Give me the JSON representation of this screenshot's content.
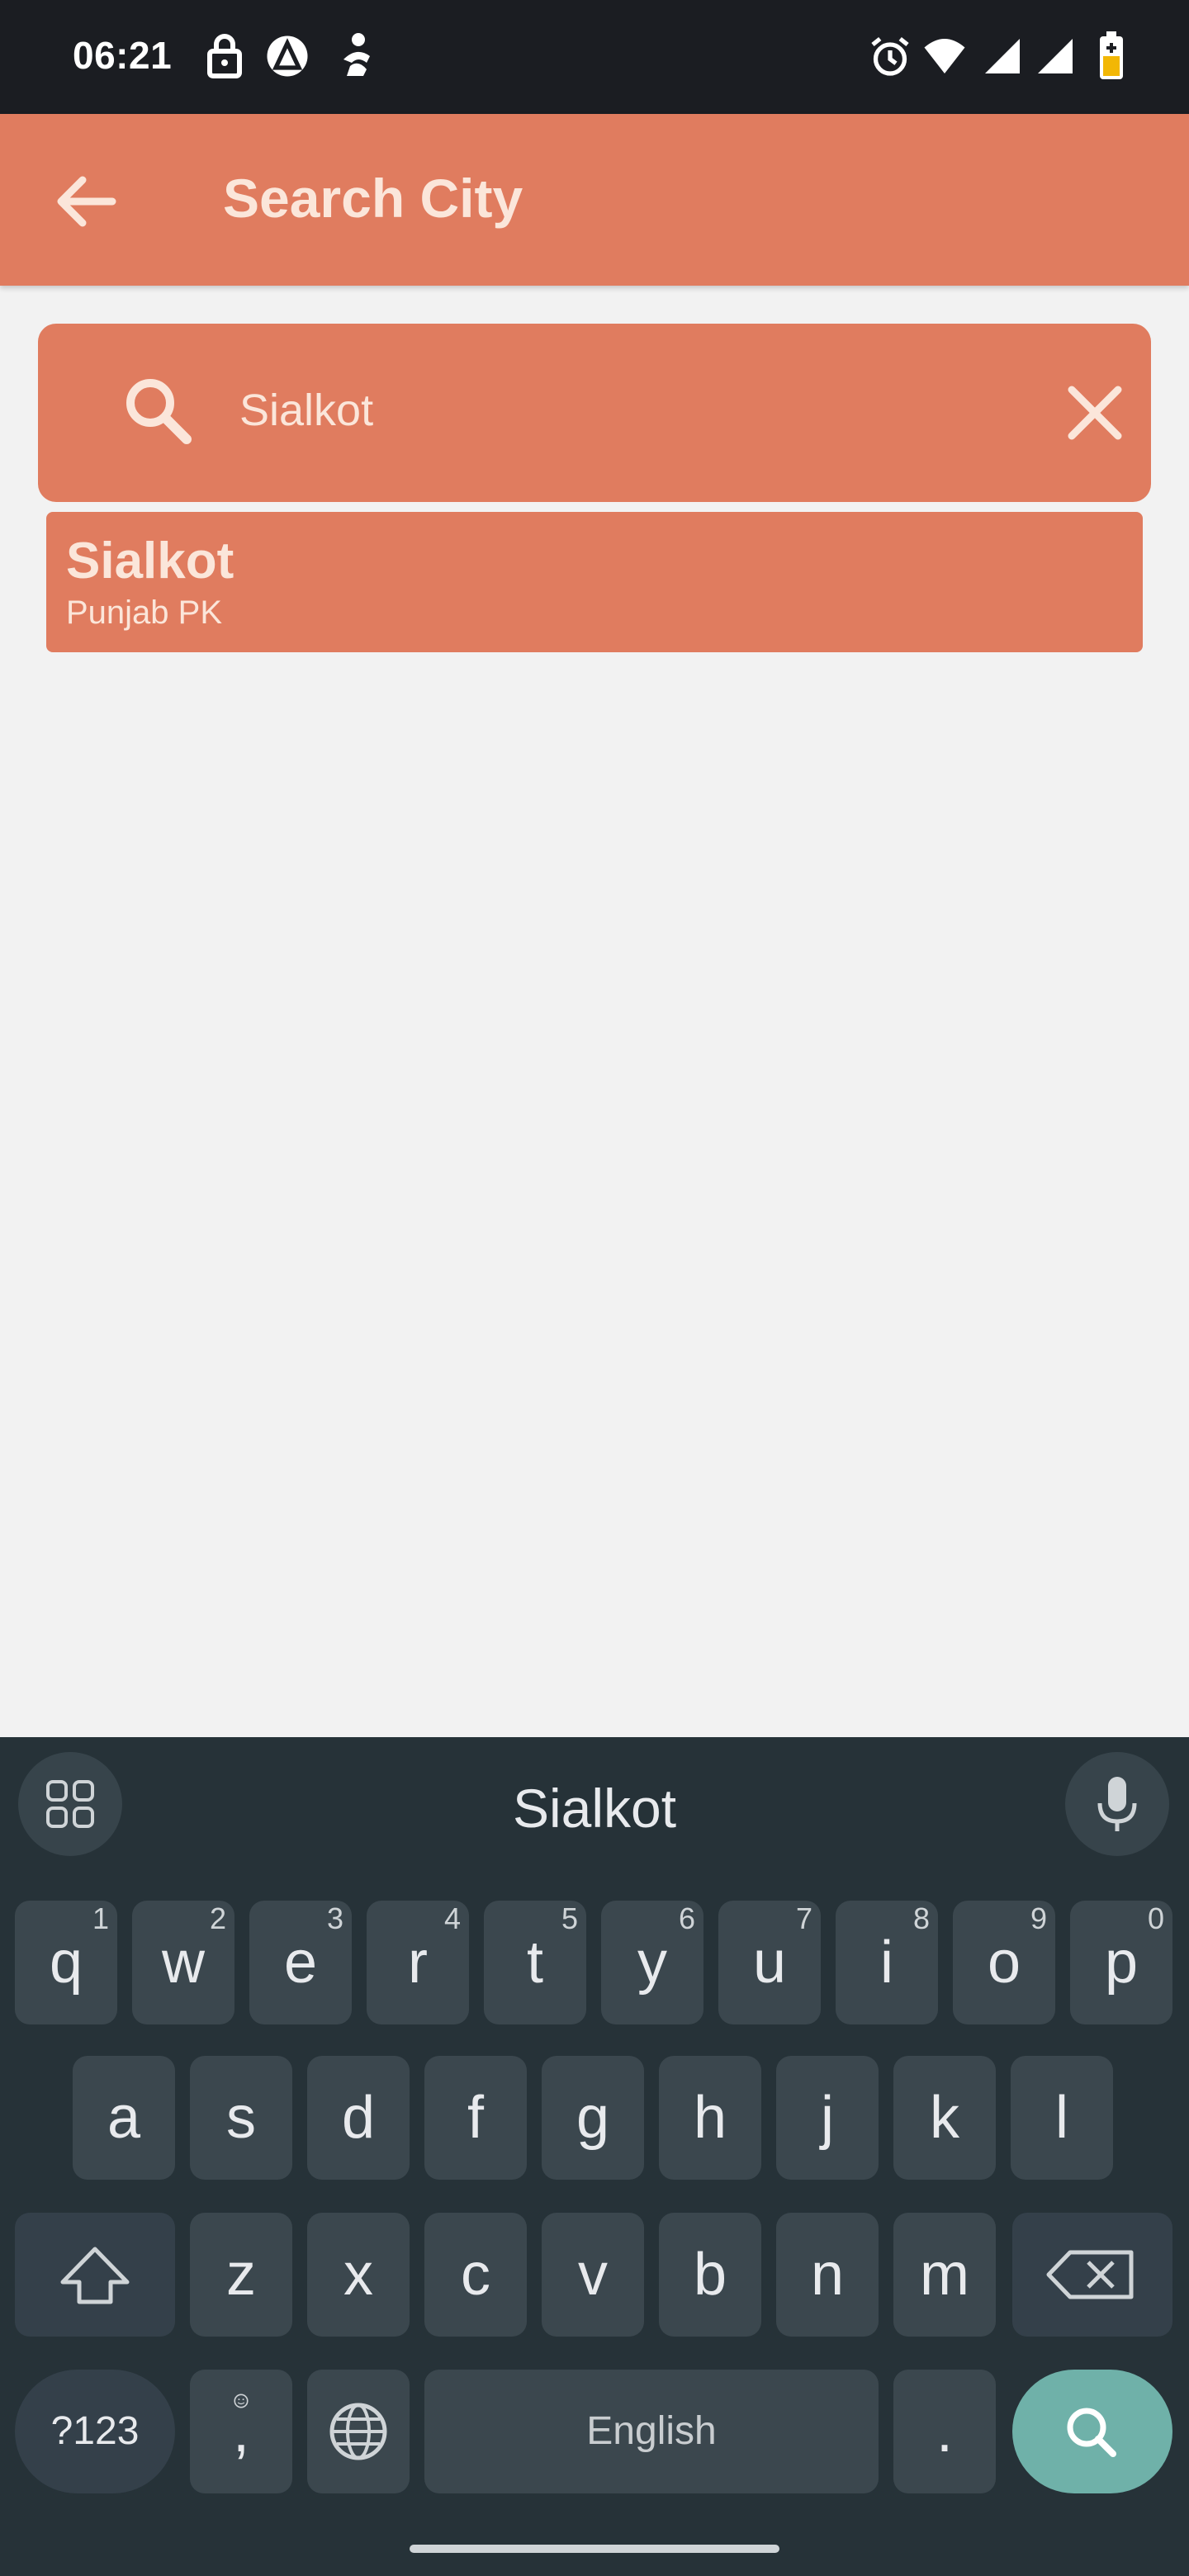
{
  "status_bar": {
    "time": "06:21",
    "left_icons": [
      "lock-icon",
      "app-notification-icon",
      "accessibility-icon"
    ],
    "right_icons": [
      "alarm-icon",
      "wifi-icon",
      "signal-icon",
      "signal-icon",
      "battery-charging-icon"
    ]
  },
  "app_bar": {
    "title": "Search City",
    "back_icon": "arrow-back-icon",
    "color": "#e07c5f"
  },
  "search": {
    "value": "Sialkot",
    "search_icon": "search-icon",
    "clear_icon": "close-icon"
  },
  "results": [
    {
      "city": "Sialkot",
      "region": "Punjab PK"
    }
  ],
  "keyboard": {
    "suggestion": "Sialkot",
    "row1": [
      {
        "k": "q",
        "h": "1"
      },
      {
        "k": "w",
        "h": "2"
      },
      {
        "k": "e",
        "h": "3"
      },
      {
        "k": "r",
        "h": "4"
      },
      {
        "k": "t",
        "h": "5"
      },
      {
        "k": "y",
        "h": "6"
      },
      {
        "k": "u",
        "h": "7"
      },
      {
        "k": "i",
        "h": "8"
      },
      {
        "k": "o",
        "h": "9"
      },
      {
        "k": "p",
        "h": "0"
      }
    ],
    "row2": [
      "a",
      "s",
      "d",
      "f",
      "g",
      "h",
      "j",
      "k",
      "l"
    ],
    "row3": [
      "z",
      "x",
      "c",
      "v",
      "b",
      "n",
      "m"
    ],
    "symbols_label": "?123",
    "comma_label": ",",
    "space_label": "English",
    "period_label": ".",
    "enter_color": "#6fb1a9"
  }
}
